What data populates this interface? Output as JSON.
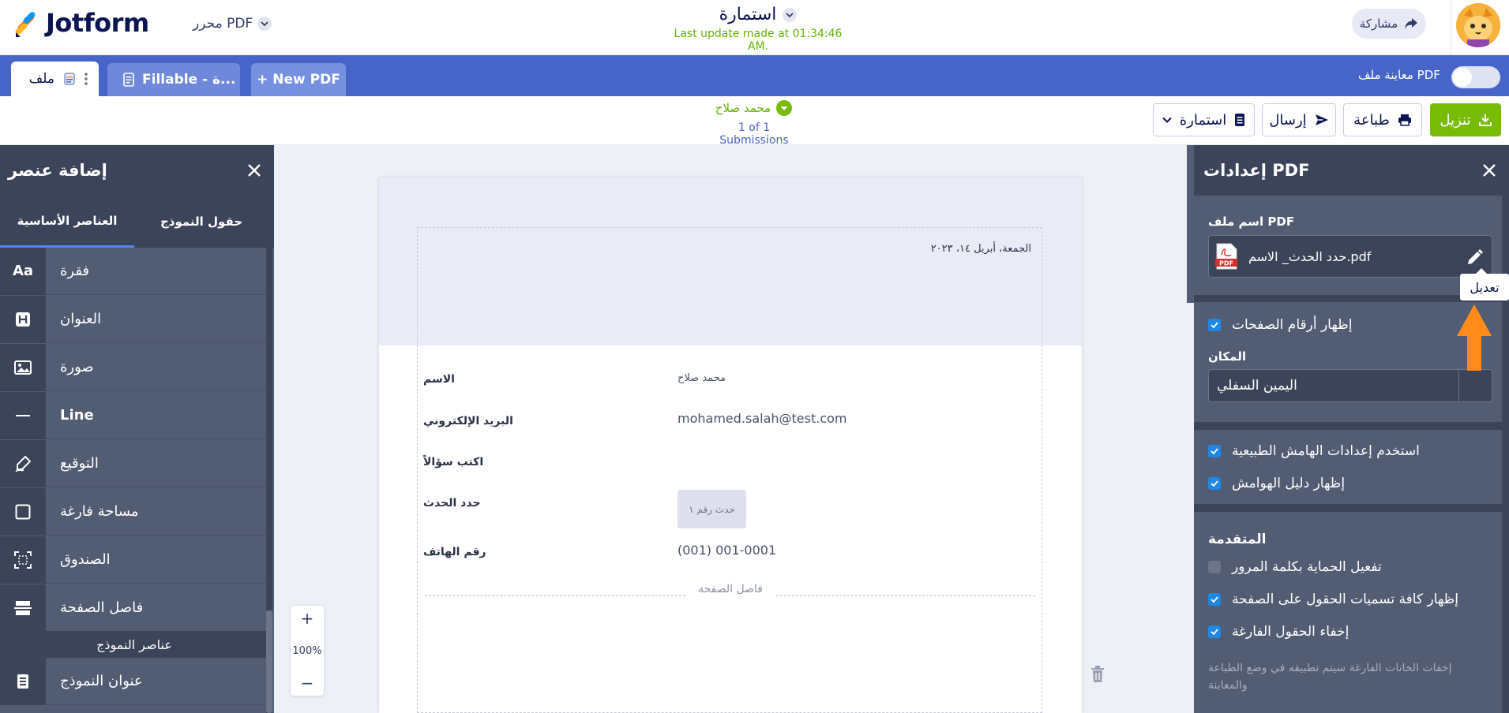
{
  "topbar": {
    "brand": "Jotform",
    "editor_label": "محرر PDF",
    "form_title": "استمارة",
    "last_update": "Last update made at 01:34:46 AM.",
    "share_label": "مشاركة"
  },
  "tabs": {
    "file_label": "ملف",
    "fillable_label": "Fillable - ة...",
    "new_pdf_label": "+ New PDF",
    "preview_label": "معاينة ملف PDF"
  },
  "actions": {
    "download_label": "تنزيل",
    "print_label": "طباعة",
    "send_label": "إرسال",
    "form_label": "استمارة",
    "submitter_name": "محمد صلاح",
    "submissions_count": "1 of 1 Submissions"
  },
  "left_panel": {
    "title": "إضافة عنصر",
    "tab_basic": "العناصر الأساسية",
    "tab_form": "حقول النموذج",
    "items": [
      {
        "label": "فقرة",
        "icon": "Aa"
      },
      {
        "label": "العنوان",
        "icon": "H"
      },
      {
        "label": "صورة",
        "icon": "image-icon"
      },
      {
        "label": "Line",
        "icon": "—"
      },
      {
        "label": "التوقيع",
        "icon": "signature-icon"
      },
      {
        "label": "مساحة فارغة",
        "icon": "square-icon"
      },
      {
        "label": "الصندوق",
        "icon": "box-icon"
      },
      {
        "label": "فاصل الصفحة",
        "icon": "page-break-icon"
      }
    ],
    "section_label": "عناصر النموذج",
    "form_items": [
      {
        "label": "عنوان النموذج",
        "icon": "form-title-icon"
      }
    ]
  },
  "document": {
    "date": "الجمعة، أبريل ١٤، ٢٠٢٣",
    "fields": [
      {
        "label": "الاسم",
        "value": "محمد صلاح"
      },
      {
        "label": "البريد الإلكتروني",
        "value": "mohamed.salah@test.com"
      },
      {
        "label": "اكتب سؤالاً",
        "value": ""
      },
      {
        "label": "حدد الحدث",
        "value": "حدث رقم ١"
      },
      {
        "label": "رقم الهاتف",
        "value": "(001) 001-0001"
      }
    ],
    "page_break_label": "فاصل الصفحة",
    "zoom": "100%"
  },
  "right_panel": {
    "title": "إعدادات PDF",
    "file_name_label": "اسم ملف PDF",
    "file_name": "حدد الحدث_ الاسم.pdf",
    "tooltip": "تعديل",
    "show_page_numbers": "إظهار أرقام الصفحات",
    "position_label": "المكان",
    "position_value": "اليمين السفلي",
    "use_natural_margins": "استخدم إعدادات الهامش الطبيعية",
    "show_margin_guide": "إظهار دليل الهوامش",
    "advanced_title": "المتقدمة",
    "enable_password": "تفعيل الحماية بكلمة المرور",
    "show_all_labels": "إظهار كافة تسميات الحقول على الصفحة",
    "hide_empty_fields": "إخفاء الحقول الفارغة",
    "hide_empty_note": "إخفات الخانات الفارغة سيتم تطبيقه في وضع الطباعة والمعاينة"
  },
  "colors": {
    "brand_blue": "#4764c9",
    "accent_green": "#78bb07",
    "panel_dark": "#3c4459",
    "checkbox_blue": "#1e88e5",
    "arrow_orange": "#ff8c1a"
  }
}
